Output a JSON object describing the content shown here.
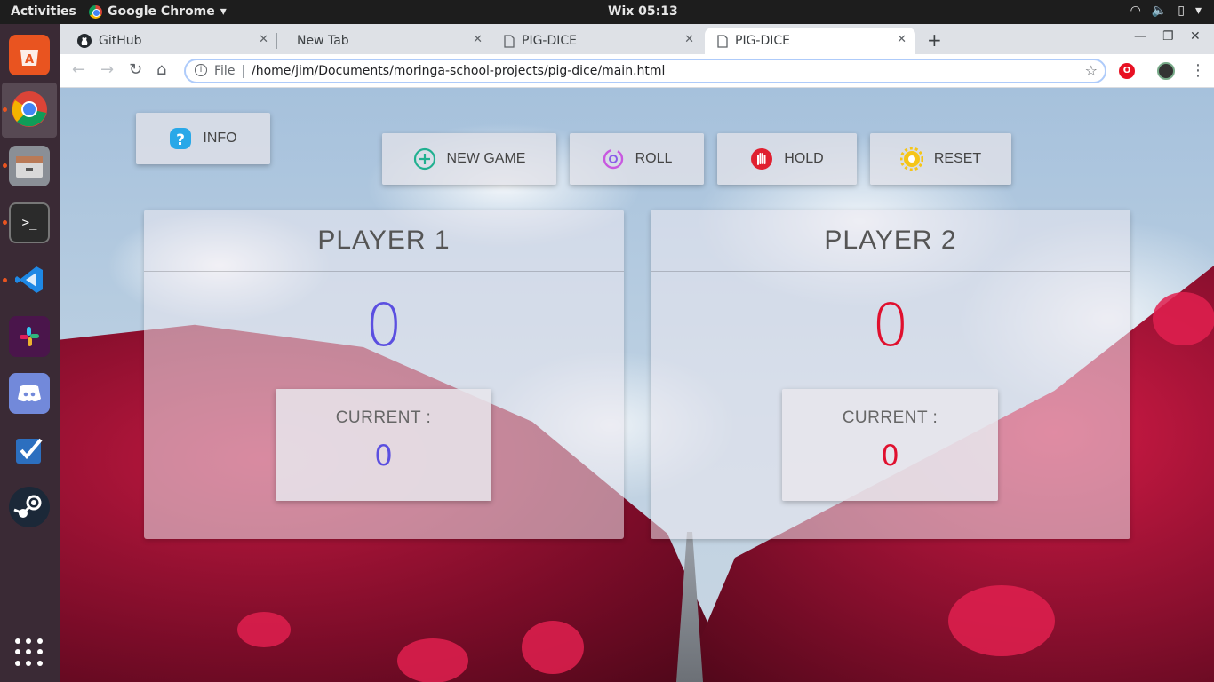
{
  "system": {
    "activities": "Activities",
    "app_name": "Google Chrome",
    "clock": "Wix 05:13"
  },
  "browser": {
    "tabs": [
      {
        "label": "GitHub",
        "icon": "github-icon"
      },
      {
        "label": "New Tab",
        "icon": ""
      },
      {
        "label": "PIG-DICE",
        "icon": "page-icon"
      },
      {
        "label": "PIG-DICE",
        "icon": "page-icon",
        "active": true
      }
    ],
    "omnibox": {
      "scheme_label": "File",
      "url": "/home/jim/Documents/moringa-school-projects/pig-dice/main.html"
    }
  },
  "game": {
    "info_label": "INFO",
    "new_game_label": "NEW GAME",
    "roll_label": "ROLL",
    "hold_label": "HOLD",
    "reset_label": "RESET",
    "players": [
      {
        "name": "PLAYER 1",
        "score": "0",
        "current_label": "CURRENT :",
        "current": "0",
        "color": "#5b4fe0"
      },
      {
        "name": "PLAYER 2",
        "score": "0",
        "current_label": "CURRENT :",
        "current": "0",
        "color": "#e0102e"
      }
    ]
  },
  "colors": {
    "accent_purple": "#5b4fe0",
    "accent_red": "#e0102e",
    "ubuntu_orange": "#e95420"
  }
}
